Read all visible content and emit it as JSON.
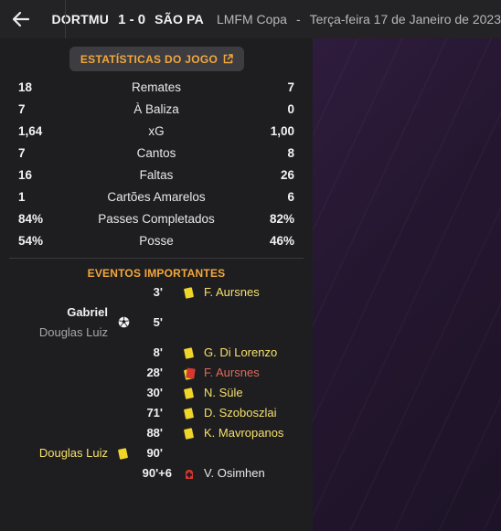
{
  "header": {
    "home_team": "DORTMU",
    "score": "1 - 0",
    "away_team": "SÃO PA",
    "competition": "LMFM Copa",
    "separator": "-",
    "date": "Terça-feira 17 de Janeiro de 2023"
  },
  "stats_button_label": "ESTATÍSTICAS DO JOGO",
  "stats": [
    {
      "home": "18",
      "label": "Remates",
      "away": "7"
    },
    {
      "home": "7",
      "label": "À Baliza",
      "away": "0"
    },
    {
      "home": "1,64",
      "label": "xG",
      "away": "1,00"
    },
    {
      "home": "7",
      "label": "Cantos",
      "away": "8"
    },
    {
      "home": "16",
      "label": "Faltas",
      "away": "26"
    },
    {
      "home": "1",
      "label": "Cartões Amarelos",
      "away": "6"
    },
    {
      "home": "84%",
      "label": "Passes Completados",
      "away": "82%"
    },
    {
      "home": "54%",
      "label": "Posse",
      "away": "46%"
    }
  ],
  "events_title": "EVENTOS IMPORTANTES",
  "events": {
    "e1": {
      "minute": "3'",
      "player": "F. Aursnes",
      "icon": "yellow-card-icon"
    },
    "goal": {
      "minute": "5'",
      "scorer": "Gabriel",
      "assist": "Douglas Luiz",
      "icon": "football-icon"
    },
    "e3": {
      "minute": "8'",
      "player": "G. Di Lorenzo",
      "icon": "yellow-card-icon"
    },
    "e4": {
      "minute": "28'",
      "player": "F. Aursnes",
      "icon": "red-card-icon"
    },
    "e5": {
      "minute": "30'",
      "player": "N. Süle",
      "icon": "yellow-card-icon"
    },
    "e6": {
      "minute": "71'",
      "player": "D. Szoboszlai",
      "icon": "yellow-card-icon"
    },
    "e7": {
      "minute": "88'",
      "player": "K. Mavropanos",
      "icon": "yellow-card-icon"
    },
    "e8": {
      "minute": "90'",
      "player": "Douglas Luiz",
      "icon": "yellow-card-icon"
    },
    "e9": {
      "minute": "90'+6",
      "player": "V. Osimhen",
      "icon": "injury-icon"
    }
  },
  "colors": {
    "accent": "#f2a73b",
    "yellow_card": "#f0d629",
    "red_card": "#d8382f",
    "injury": "#d8382f"
  }
}
